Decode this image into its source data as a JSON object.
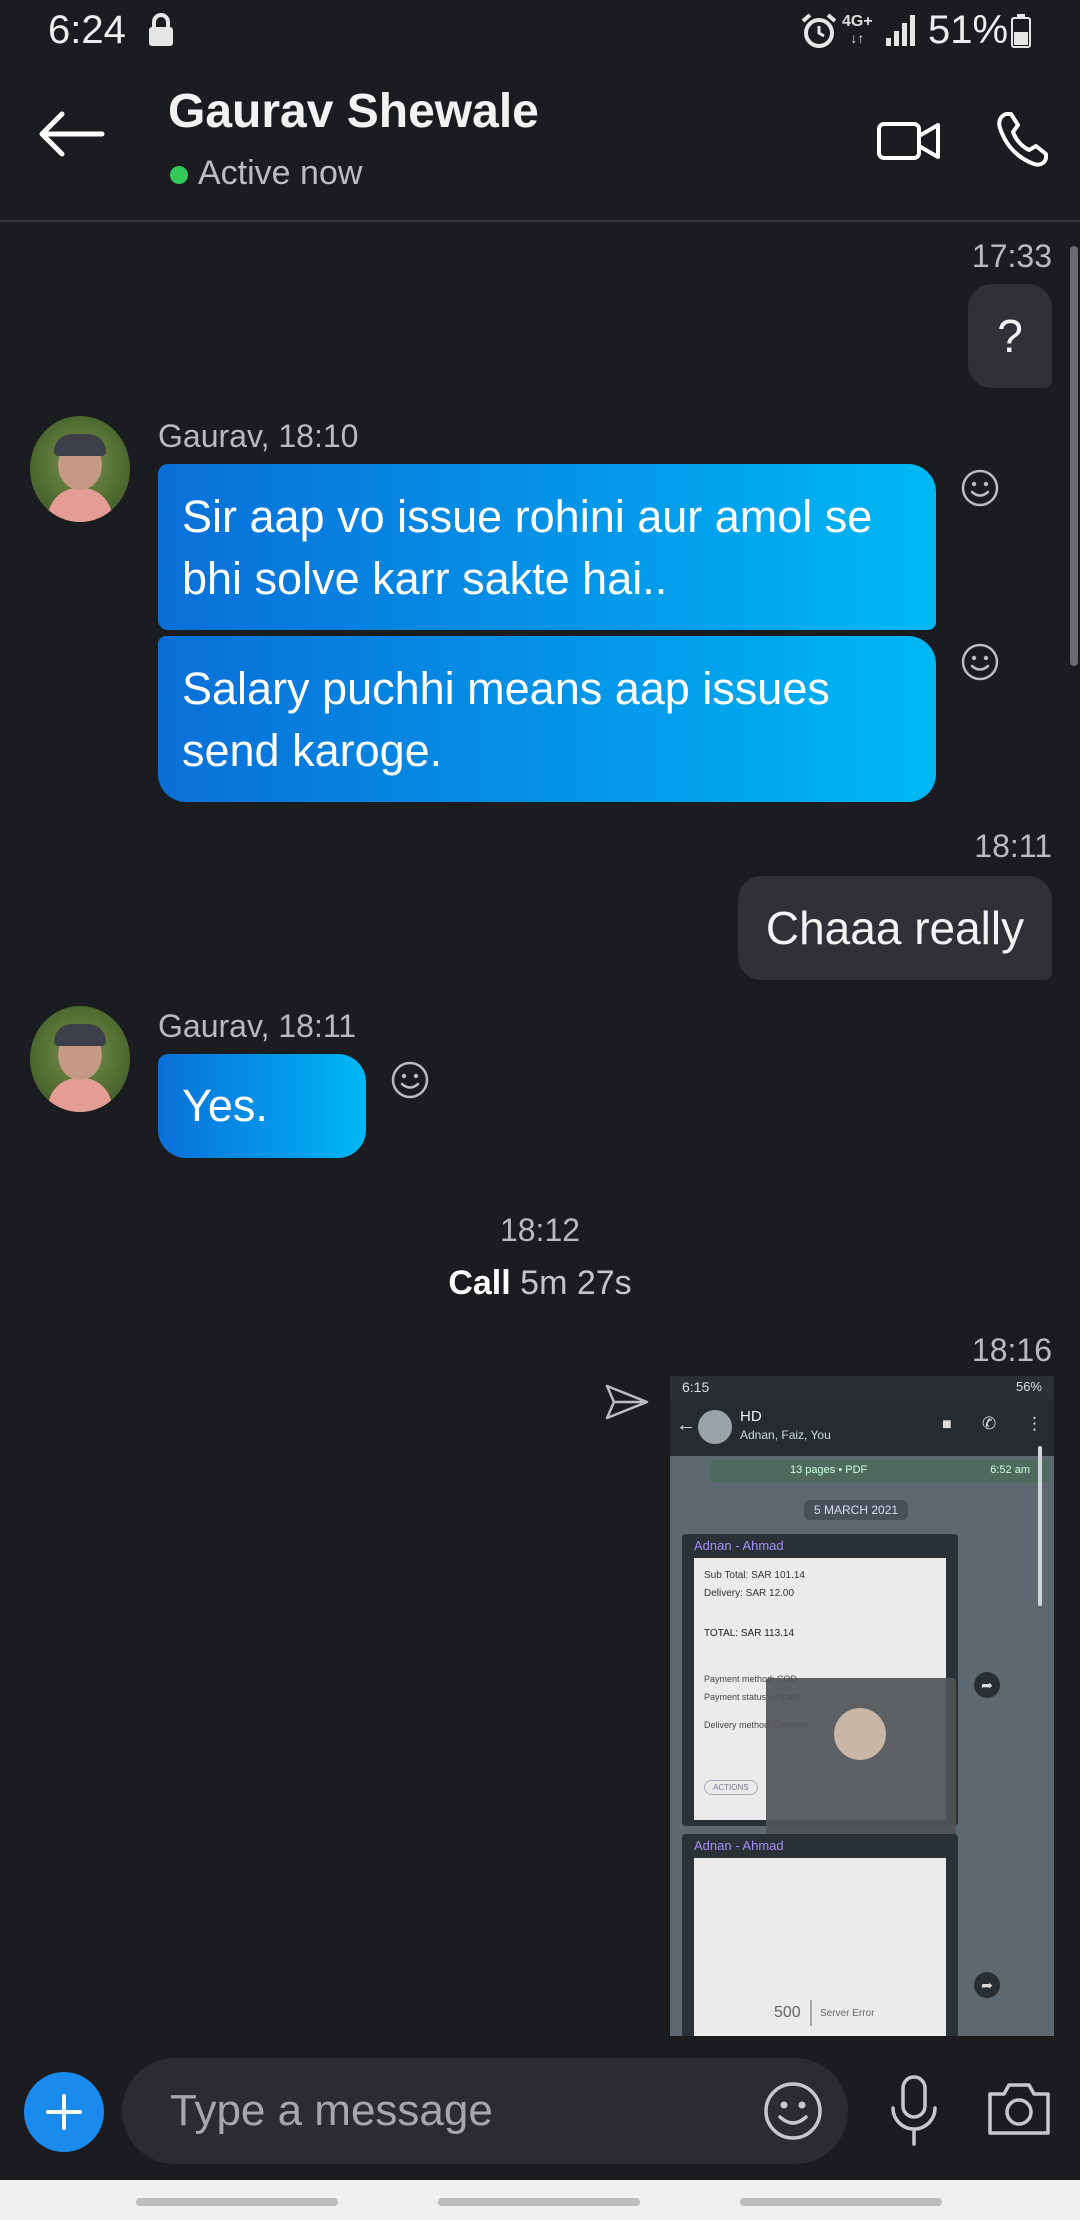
{
  "status_bar": {
    "time": "6:24",
    "network": "4G+",
    "battery": "51%"
  },
  "header": {
    "contact_name": "Gaurav Shewale",
    "presence": "Active now",
    "presence_color": "#34c759"
  },
  "messages": [
    {
      "direction": "out",
      "timestamp": "17:33",
      "text": "?"
    },
    {
      "direction": "in",
      "sender_meta": "Gaurav, 18:10",
      "texts": [
        "Sir aap vo issue rohini aur amol se",
        "bhi solve karr sakte hai..",
        "Salary puchhi means aap issues",
        "send karoge."
      ]
    },
    {
      "direction": "out",
      "timestamp": "18:11",
      "text": "Chaaa really"
    },
    {
      "direction": "in",
      "sender_meta": "Gaurav, 18:11",
      "text": "Yes."
    }
  ],
  "call": {
    "time": "18:12",
    "label": "Call",
    "duration": "5m 27s"
  },
  "shared_image_message": {
    "timestamp": "18:16",
    "screenshot": {
      "status_time": "6:15",
      "status_battery": "56%",
      "chat_title": "HD",
      "chat_members": "Adnan, Faiz, You",
      "pdf_label": "13 pages • PDF",
      "pdf_time": "6:52 am",
      "date_chip": "5 MARCH 2021",
      "sender1": "Adnan - Ahmad",
      "sub_total": "Sub Total: SAR 101.14",
      "delivery": "Delivery: SAR 12.00",
      "total": "TOTAL: SAR 113.14",
      "payment_method": "Payment method: COD",
      "payment_status": "Payment status: Unpaid",
      "delivery_method": "Delivery method: Delivery",
      "actions": "ACTIONS",
      "sender2": "Adnan - Ahmad",
      "error_code": "500",
      "error_text": "Server Error"
    }
  },
  "composer": {
    "placeholder": "Type a message"
  },
  "colors": {
    "background": "#1b1c20",
    "incoming_gradient_start": "#0a6fd8",
    "incoming_gradient_end": "#00b8f4",
    "outgoing_bubble": "#303136",
    "accent": "#1a8bec"
  },
  "icons": [
    "lock-icon",
    "alarm-icon",
    "signal-icon",
    "battery-icon",
    "back-arrow-icon",
    "video-camera-icon",
    "phone-icon",
    "smiley-reaction-icon",
    "send-status-icon",
    "plus-icon",
    "emoji-icon",
    "microphone-icon",
    "camera-icon"
  ]
}
